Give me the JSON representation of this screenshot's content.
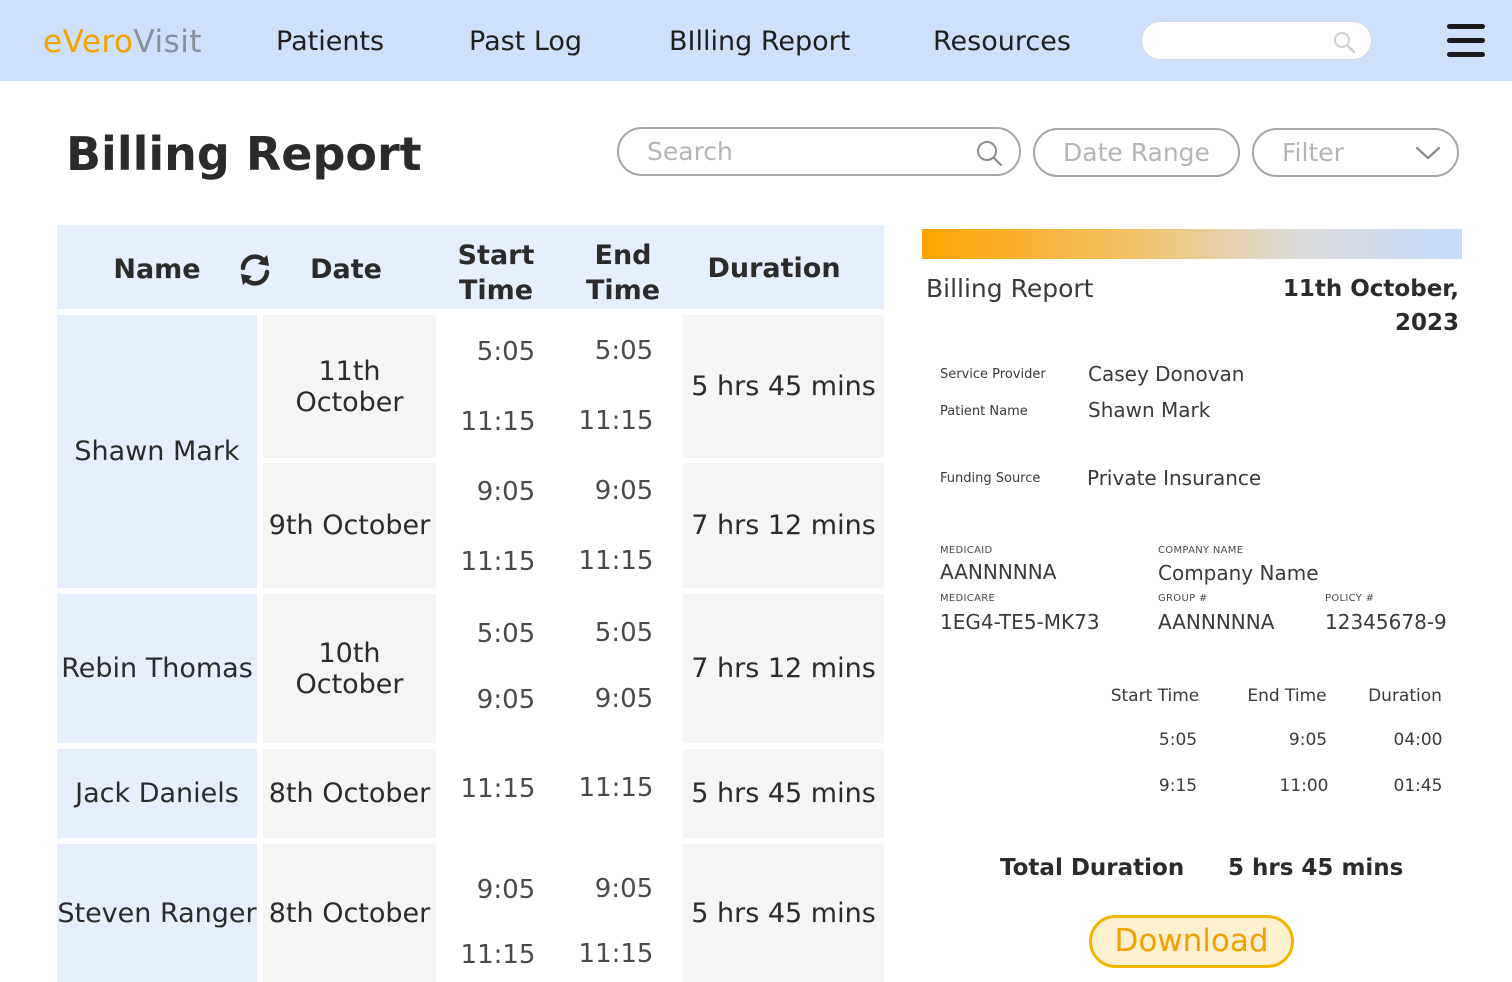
{
  "brand": {
    "logo_part1": "eVero",
    "logo_part2": "Visit"
  },
  "nav": {
    "items": [
      {
        "label": "Patients"
      },
      {
        "label": "Past Log"
      },
      {
        "label": "BIlling Report"
      },
      {
        "label": "Resources"
      }
    ],
    "search_placeholder": ""
  },
  "page": {
    "title": "Billing Report",
    "search_placeholder": "Search",
    "date_range_label": "Date Range",
    "filter_label": "Filter"
  },
  "table": {
    "headers": {
      "name": "Name",
      "date": "Date",
      "start_time": "Start Time",
      "end_time": "End Time",
      "duration": "Duration"
    },
    "rows": [
      {
        "name": "Shawn Mark",
        "entries": [
          {
            "date": "11th October",
            "start": [
              "5:05",
              "11:15"
            ],
            "end": [
              "5:05",
              "11:15"
            ],
            "duration": "5 hrs 45 mins"
          },
          {
            "date": "9th October",
            "start": [
              "9:05",
              "11:15"
            ],
            "end": [
              "9:05",
              "11:15"
            ],
            "duration": "7 hrs 12 mins"
          }
        ]
      },
      {
        "name": "Rebin Thomas",
        "entries": [
          {
            "date": "10th October",
            "start": [
              "5:05",
              "9:05"
            ],
            "end": [
              "5:05",
              "9:05"
            ],
            "duration": "7 hrs 12 mins"
          }
        ]
      },
      {
        "name": "Jack Daniels",
        "entries": [
          {
            "date": "8th October",
            "start": [
              "11:15"
            ],
            "end": [
              "11:15"
            ],
            "duration": "5 hrs 45 mins"
          }
        ]
      },
      {
        "name": "Steven Ranger",
        "entries": [
          {
            "date": "8th October",
            "start": [
              "9:05",
              "11:15"
            ],
            "end": [
              "9:05",
              "11:15"
            ],
            "duration": "5 hrs 45 mins"
          }
        ]
      }
    ]
  },
  "detail": {
    "title": "Billing Report",
    "date": "11th October, 2023",
    "service_provider_label": "Service Provider",
    "service_provider": "Casey Donovan",
    "patient_name_label": "Patient Name",
    "patient_name": "Shawn Mark",
    "funding_source_label": "Funding Source",
    "funding_source": "Private Insurance",
    "medicaid_label": "MEDICAID",
    "medicaid": "AANNNNNA",
    "company_name_label": "COMPANY NAME",
    "company_name": "Company Name",
    "medicare_label": "MEDICARE",
    "medicare": "1EG4-TE5-MK73",
    "group_label": "GROUP #",
    "group": "AANNNNNA",
    "policy_label": "POLICY #",
    "policy": "12345678-9",
    "sessions_headers": {
      "start": "Start Time",
      "end": "End Time",
      "duration": "Duration"
    },
    "sessions": [
      {
        "start": "5:05",
        "end": "9:05",
        "duration": "04:00"
      },
      {
        "start": "9:15",
        "end": "11:00",
        "duration": "01:45"
      }
    ],
    "total_label": "Total Duration",
    "total_value": "5 hrs 45 mins",
    "download_label": "Download"
  },
  "colors": {
    "accent": "#f2a100",
    "nav_bg": "#cfe0fa",
    "name_cell_bg": "#e6effc",
    "data_cell_bg": "#f5f5f5"
  }
}
